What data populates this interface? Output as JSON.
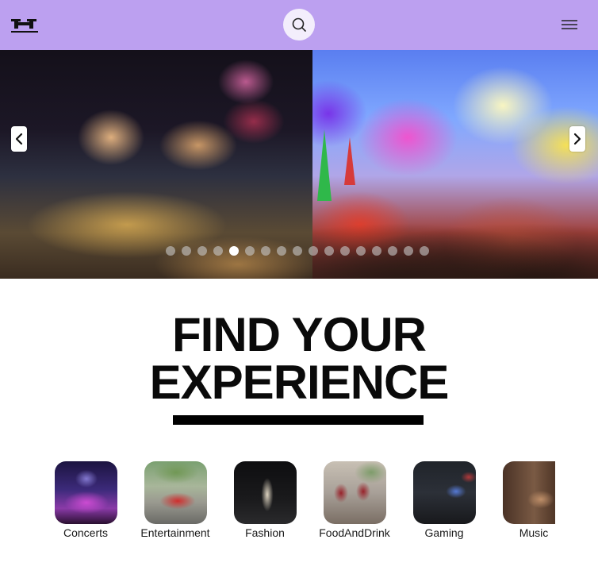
{
  "header": {
    "logo_icon": "h-logo-icon",
    "search_icon": "search-icon",
    "menu_icon": "hamburger-menu-icon",
    "background_color": "#bca0f0"
  },
  "carousel": {
    "prev_icon": "chevron-left-icon",
    "next_icon": "chevron-right-icon",
    "slides": [
      {
        "subject": "fireworks over city crowd"
      },
      {
        "subject": "color powder festival crowd"
      }
    ],
    "dot_count": 17,
    "active_dot": 5
  },
  "main": {
    "headline_line1": "FIND YOUR",
    "headline_line2": "EXPERIENCE"
  },
  "categories": [
    {
      "label": "Concerts"
    },
    {
      "label": "Entertainment"
    },
    {
      "label": "Fashion"
    },
    {
      "label": "FoodAndDrink"
    },
    {
      "label": "Gaming"
    },
    {
      "label": "Music"
    }
  ]
}
